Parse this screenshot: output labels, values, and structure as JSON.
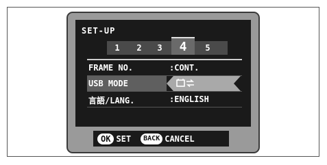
{
  "title": "SET-UP",
  "tabs": [
    {
      "label": "1",
      "active": false
    },
    {
      "label": "2",
      "active": false
    },
    {
      "label": "3",
      "active": false
    },
    {
      "label": "4",
      "active": true
    },
    {
      "label": "5",
      "active": false
    }
  ],
  "rows": [
    {
      "label": "FRAME NO.",
      "value": ":CONT.",
      "selected": false
    },
    {
      "label": "USB MODE",
      "value": "",
      "value_icon": "usb-camera-icon",
      "selected": true
    },
    {
      "label": "言語/LANG.",
      "value": ":ENGLISH",
      "selected": false
    }
  ],
  "footer": {
    "ok_label": "OK",
    "set_label": "SET",
    "back_label": "BACK",
    "cancel_label": "CANCEL"
  },
  "colors": {
    "panel": "#1a1a1a",
    "highlight": "#a9a9a9",
    "screen_bezel": "#9a9a9a"
  }
}
